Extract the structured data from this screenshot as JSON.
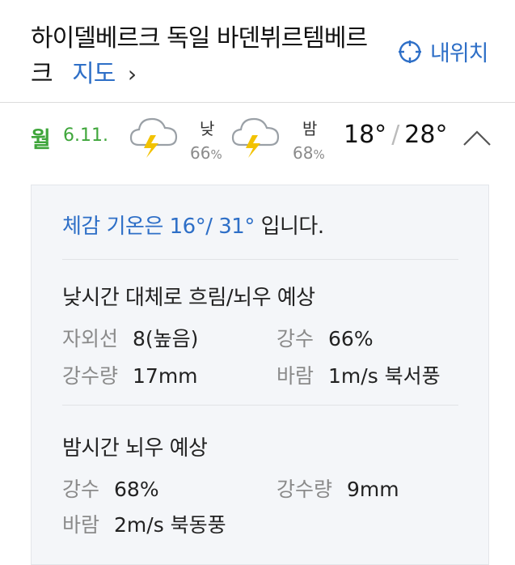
{
  "header": {
    "title_line1": "하이델베르크 독일 바덴뷔르템베르",
    "title_line2": "크",
    "map_link": "지도",
    "map_chevron": "›",
    "location_button": "내위치"
  },
  "day": {
    "weekday": "월",
    "date": "6.11.",
    "day_label": "낮",
    "day_pct": "66",
    "night_label": "밤",
    "night_pct": "68",
    "pct_unit": "%",
    "low": "18°",
    "high": "28°",
    "separator": "/",
    "day_icon": "thunderstorm-icon",
    "night_icon": "thunderstorm-icon"
  },
  "detail": {
    "feels_prefix": "체감 기온은 16°/ 31°",
    "feels_suffix": " 입니다.",
    "day_section": {
      "title": "낮시간 대체로 흐림/뇌우 예상",
      "uv_label": "자외선",
      "uv_value": "8(높음)",
      "rain_label": "강수",
      "rain_value": "66%",
      "amount_label": "강수량",
      "amount_value": "17mm",
      "wind_label": "바람",
      "wind_value": "1m/s 북서풍"
    },
    "night_section": {
      "title": "밤시간 뇌우 예상",
      "rain_label": "강수",
      "rain_value": "68%",
      "amount_label": "강수량",
      "amount_value": "9mm",
      "wind_label": "바람",
      "wind_value": "2m/s 북동풍"
    }
  },
  "colors": {
    "accent_blue": "#2e6fc7",
    "weekday_green": "#3fa63b",
    "lightning_yellow": "#f2c200"
  }
}
